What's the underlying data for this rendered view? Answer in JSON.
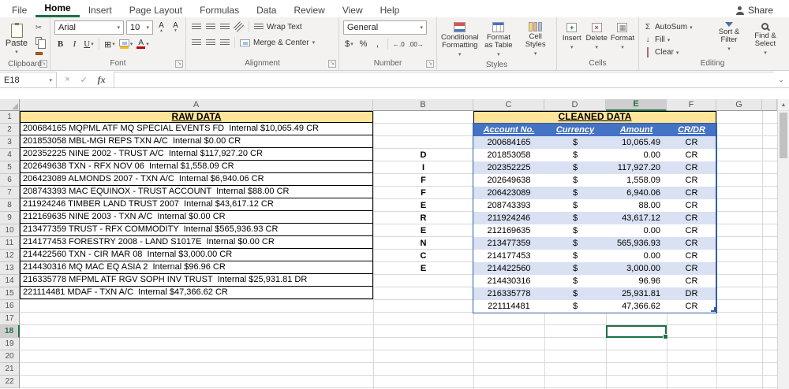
{
  "colors": {
    "accent_green": "#1e7145",
    "table_header_blue": "#4472c4",
    "band_blue": "#d9e1f2",
    "title_tan": "#ffe599",
    "table_border_blue": "#2e5fa3"
  },
  "icons": {
    "dropdown": "▾",
    "launcher": "↘",
    "cut": "✂",
    "sigma": "Σ",
    "fill_arrow": "↓",
    "up_small": "▲",
    "down_small": "▼",
    "check": "✓",
    "close": "×",
    "chevron": "⌄",
    "borders": "⊞",
    "insert_glyph": "+",
    "delete_glyph": "×",
    "format_glyph": "▦",
    "scroll_up": "▲"
  },
  "ribbon": {
    "tabs": [
      "File",
      "Home",
      "Insert",
      "Page Layout",
      "Formulas",
      "Data",
      "Review",
      "View",
      "Help"
    ],
    "active_tab": "Home",
    "share_label": "Share",
    "clipboard": {
      "label": "Clipboard",
      "paste": "Paste"
    },
    "font": {
      "label": "Font",
      "name": "Arial",
      "size": "10",
      "bold": "B",
      "italic": "I",
      "underline": "U",
      "grow": "A",
      "shrink": "A",
      "color_letter": "A"
    },
    "alignment": {
      "label": "Alignment",
      "wrap_text": "Wrap Text",
      "merge_center": "Merge & Center"
    },
    "number": {
      "label": "Number",
      "format": "General",
      "currency": "$",
      "percent": "%",
      "comma": ",",
      "inc_decimal": "←.0",
      "dec_decimal": ".00→"
    },
    "styles": {
      "label": "Styles",
      "conditional": "Conditional Formatting",
      "format_table": "Format as Table",
      "cell_styles": "Cell Styles"
    },
    "cells": {
      "label": "Cells",
      "insert": "Insert",
      "delete": "Delete",
      "format": "Format"
    },
    "editing": {
      "label": "Editing",
      "autosum": "AutoSum",
      "fill": "Fill",
      "clear": "Clear",
      "sort_filter": "Sort & Filter",
      "find_select": "Find & Select"
    }
  },
  "formula_bar": {
    "name_box": "E18",
    "fx": "fx",
    "value": ""
  },
  "sheet": {
    "columns": [
      "A",
      "B",
      "C",
      "D",
      "E",
      "F",
      "G"
    ],
    "active_cell": "E18",
    "row_numbers": [
      "1",
      "2",
      "3",
      "4",
      "5",
      "6",
      "7",
      "8",
      "9",
      "10",
      "11",
      "12",
      "13",
      "14",
      "15",
      "16",
      "17",
      "18",
      "19",
      "20",
      "21",
      "22"
    ],
    "raw": {
      "title": "RAW DATA",
      "entries": [
        "200684165 MQPML ATF MQ SPECIAL EVENTS FD  Internal $10,065.49 CR",
        "201853058 MBL-MGI REPS TXN A/C  Internal $0.00 CR",
        "202352225 NINE 2002 - TRUST A/C  Internal $117,927.20 CR",
        "202649638 TXN - RFX NOV 06  Internal $1,558.09 CR",
        "206423089 ALMONDS 2007 - TXN A/C  Internal $6,940.06 CR",
        "208743393 MAC EQUINOX - TRUST ACCOUNT  Internal $88.00 CR",
        "211924246 TIMBER LAND TRUST 2007  Internal $43,617.12 CR",
        "212169635 NINE 2003 - TXN A/C  Internal $0.00 CR",
        "213477359 TRUST - RFX COMMODITY  Internal $565,936.93 CR",
        "214177453 FORESTRY 2008 - LAND S1017E  Internal $0.00 CR",
        "214422560 TXN - CIR MAR 08  Internal $3,000.00 CR",
        "214430316 MQ MAC EQ ASIA 2  Internal $96.96 CR",
        "216335778 MFPML ATF RGV SOPH INV TRUST  Internal $25,931.81 DR",
        "221114481 MDAF - TXN A/C  Internal $47,366.62 CR"
      ]
    },
    "difference_letters": [
      "D",
      "I",
      "F",
      "F",
      "E",
      "R",
      "E",
      "N",
      "C",
      "E"
    ],
    "cleaned": {
      "title": "CLEANED DATA",
      "headers": [
        "Account No.",
        "Currency",
        "Amount",
        "CR/DR"
      ],
      "rows": [
        [
          "200684165",
          "$",
          "10,065.49",
          "CR"
        ],
        [
          "201853058",
          "$",
          "0.00",
          "CR"
        ],
        [
          "202352225",
          "$",
          "117,927.20",
          "CR"
        ],
        [
          "202649638",
          "$",
          "1,558.09",
          "CR"
        ],
        [
          "206423089",
          "$",
          "6,940.06",
          "CR"
        ],
        [
          "208743393",
          "$",
          "88.00",
          "CR"
        ],
        [
          "211924246",
          "$",
          "43,617.12",
          "CR"
        ],
        [
          "212169635",
          "$",
          "0.00",
          "CR"
        ],
        [
          "213477359",
          "$",
          "565,936.93",
          "CR"
        ],
        [
          "214177453",
          "$",
          "0.00",
          "CR"
        ],
        [
          "214422560",
          "$",
          "3,000.00",
          "CR"
        ],
        [
          "214430316",
          "$",
          "96.96",
          "CR"
        ],
        [
          "216335778",
          "$",
          "25,931.81",
          "DR"
        ],
        [
          "221114481",
          "$",
          "47,366.62",
          "CR"
        ]
      ]
    }
  }
}
